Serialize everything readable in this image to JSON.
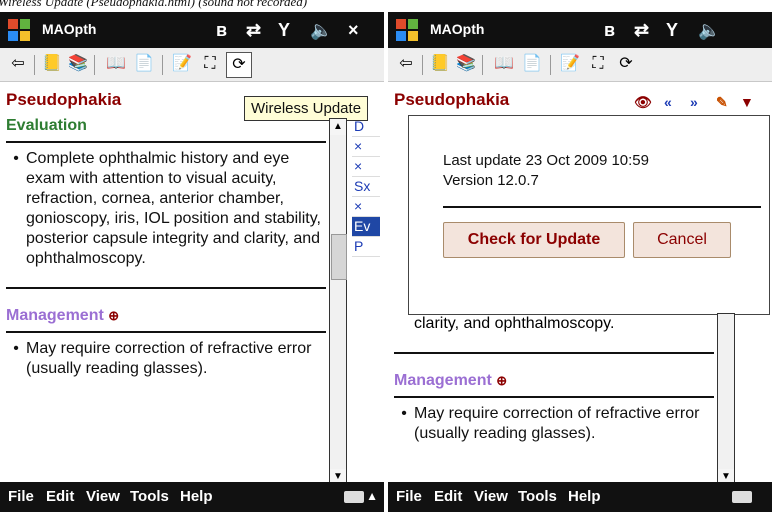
{
  "caption": "Wireless Update (Pseudophakia.html) (sound not recorded)",
  "app": {
    "title": "MAOpth"
  },
  "menu": [
    "File",
    "Edit",
    "View",
    "Tools",
    "Help"
  ],
  "page": {
    "heading": "Pseudophakia",
    "evaluation_title": "Evaluation",
    "evaluation_bullets": [
      "Complete ophthalmic history and eye exam with attention to visual acuity, refraction, cornea, anterior chamber, gonioscopy, iris, IOL position and stability, posterior capsule integrity and clarity, and ophthalmoscopy."
    ],
    "management_title": "Management",
    "management_bullets": [
      "May require correction of refractive error (usually reading glasses)."
    ]
  },
  "section_tabs": [
    "D",
    "×",
    "×",
    "Sx",
    "×",
    "Ev",
    "P"
  ],
  "tooltip": "Wireless Update",
  "dialog": {
    "last_update": "Last update 23 Oct 2009 10:59",
    "version": "Version 12.0.7",
    "check_button": "Check for Update",
    "cancel_button": "Cancel"
  },
  "visible_text_right": "clarity, and ophthalmoscopy."
}
